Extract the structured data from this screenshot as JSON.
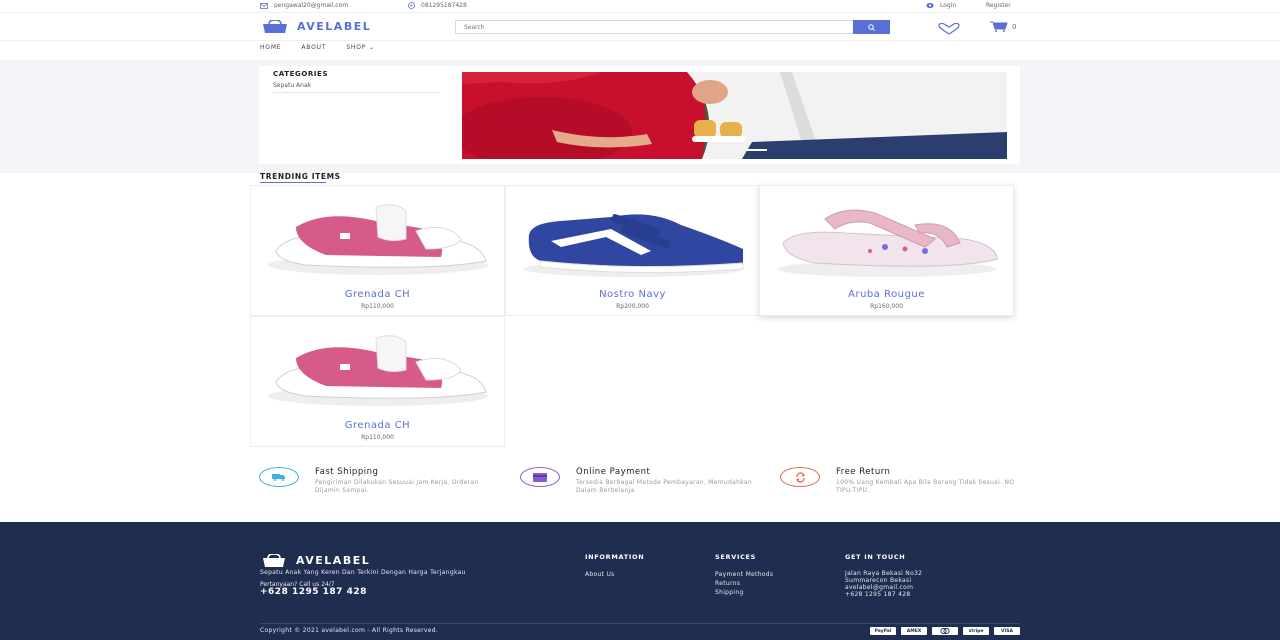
{
  "topbar": {
    "email": "pengawal20@gmail.com",
    "phone": "081295187428",
    "login": "Login",
    "register": "Register"
  },
  "header": {
    "brand": "AVELABEL",
    "search_placeholder": "Search",
    "cart_count": "0"
  },
  "nav": {
    "home": "HOME",
    "about": "ABOUT",
    "shop": "SHOP"
  },
  "categories": {
    "title": "CATEGORIES",
    "items": [
      "Sepatu Anak"
    ]
  },
  "trending": {
    "title": "TRENDING ITEMS",
    "products": [
      {
        "name": "Grenada CH",
        "price": "Rp110,000",
        "color": "#d65a8a"
      },
      {
        "name": "Nostro Navy",
        "price": "Rp200,000",
        "color": "#2f47a0"
      },
      {
        "name": "Aruba Rougue",
        "price": "Rp160,000",
        "color": "#e8b8c8"
      },
      {
        "name": "Grenada CH",
        "price": "Rp110,000",
        "color": "#d65a8a"
      }
    ]
  },
  "features": [
    {
      "title": "Fast Shipping",
      "desc": "Pengiriman Dilakukan Sesuuai Jam Kerja. Orderan Dijamin Sampai.",
      "icon": "truck-icon",
      "color": "#3fb0e0"
    },
    {
      "title": "Online Payment",
      "desc": "Tersedia Berbagai Metode Pembayaran. Memudahkan Dalam Berbelanja.",
      "icon": "credit-card-icon",
      "color": "#8a5ad6"
    },
    {
      "title": "Free Return",
      "desc": "100% Uang Kembali Apa Bila Barang Tidak Sesuai. NO TIPU-TIPU.",
      "icon": "refresh-icon",
      "color": "#e86a4a"
    }
  ],
  "footer": {
    "brand": "AVELABEL",
    "tagline": "Sepatu Anak Yang Keren Dan Terkini Dengan Harga Terjangkau",
    "ask": "Pertanyaan? Call us 24/7",
    "phone": "+628 1295 187 428",
    "information": {
      "title": "INFORMATION",
      "links": [
        "About Us"
      ]
    },
    "services": {
      "title": "SERVICES",
      "links": [
        "Payment Methods",
        "Returns",
        "Shipping"
      ]
    },
    "contact": {
      "title": "GET IN TOUCH",
      "lines": [
        "Jalan Raya Bekasi No32",
        "Summarecon Bekasi",
        "avelabel@gmail.com",
        "+628 1295 187 428"
      ]
    },
    "copyright": "Copyright © 2021 avelabel.com - All Rights Reserved.",
    "payments": [
      "PayPal",
      "AMEX",
      "MC",
      "stripe",
      "VISA"
    ]
  },
  "colors": {
    "accent": "#5a6fd6",
    "footer_bg": "#1f2d4f"
  }
}
